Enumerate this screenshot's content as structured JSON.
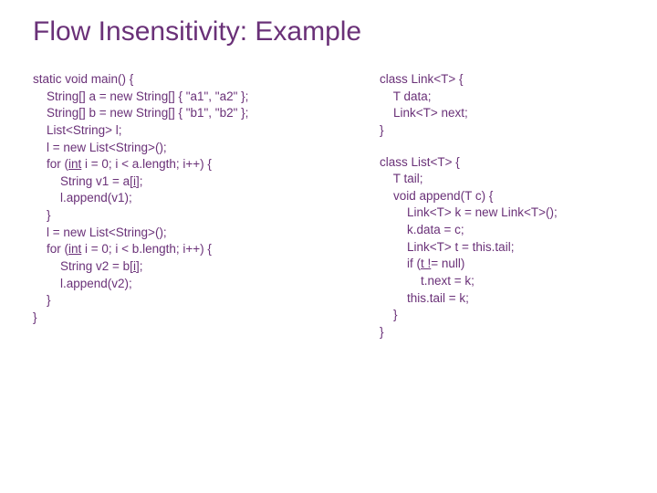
{
  "title": "Flow Insensitivity: Example",
  "left": {
    "l1": "static void main() {",
    "l2": "    String[] a = new String[] { \"a1\", \"a2\" };",
    "l3": "    String[] b = new String[] { \"b1\", \"b2\" };",
    "l4": "    List<String> l;",
    "l5": "    l = new List<String>();",
    "l6a": "    for (",
    "l6b": "int",
    "l6c": " i = 0; i < a.length; i++) {",
    "l7a": "        String v1 = a[",
    "l7b": "i",
    "l7c": "];",
    "l8": "        l.append(v1);",
    "l9": "    }",
    "l10": "    l = new List<String>();",
    "l11a": "    for (",
    "l11b": "int",
    "l11c": " i = 0; i < b.length; i++) {",
    "l12a": "        String v2 = b[",
    "l12b": "i",
    "l12c": "];",
    "l13": "        l.append(v2);",
    "l14": "    }",
    "l15": "}"
  },
  "rightA": {
    "l1": "class Link<T> {",
    "l2": "    T data;",
    "l3": "    Link<T> next;",
    "l4": "}"
  },
  "rightB": {
    "l1": "class List<T> {",
    "l2": "    T tail;",
    "l3": "    void append(T c) {",
    "l4": "        Link<T> k = new Link<T>();",
    "l5": "        k.data = c;",
    "l6": "        Link<T> t = this.tail;",
    "l7a": "        if (",
    "l7b": "t !",
    "l7c": "= null)",
    "l8": "            t.next = k;",
    "l9": "        this.tail = k;",
    "l10": "    }",
    "l11": "}"
  }
}
